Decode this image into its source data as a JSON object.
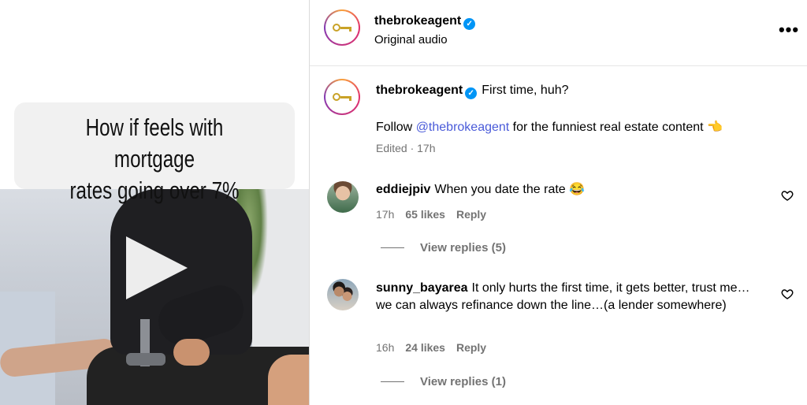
{
  "video": {
    "caption_line1": "How if feels with mortgage",
    "caption_line2": "rates going over 7%",
    "play_icon": "play-icon"
  },
  "post_header": {
    "username": "thebrokeagent",
    "verified_icon": "verified-badge-icon",
    "audio_label": "Original audio",
    "more_label": "•••"
  },
  "caption": {
    "username": "thebrokeagent",
    "text": "First time, huh?",
    "follow_prefix": "Follow ",
    "mention": "@thebrokeagent",
    "follow_suffix": " for the funniest real estate content 👈",
    "meta": "Edited · 17h"
  },
  "comments": [
    {
      "username": "eddiejpiv",
      "text": "When you date the rate 😂",
      "time": "17h",
      "likes": "65 likes",
      "reply": "Reply",
      "view_replies": "View replies (5)"
    },
    {
      "username": "sunny_bayarea",
      "text": "It only hurts the first time, it gets better, trust me… we can always refinance down the line…(a lender somewhere)",
      "time": "16h",
      "likes": "24 likes",
      "reply": "Reply",
      "view_replies": "View replies (1)"
    }
  ],
  "colors": {
    "mention": "#4a5bd9",
    "verified": "#0095f6",
    "muted": "#737373"
  }
}
